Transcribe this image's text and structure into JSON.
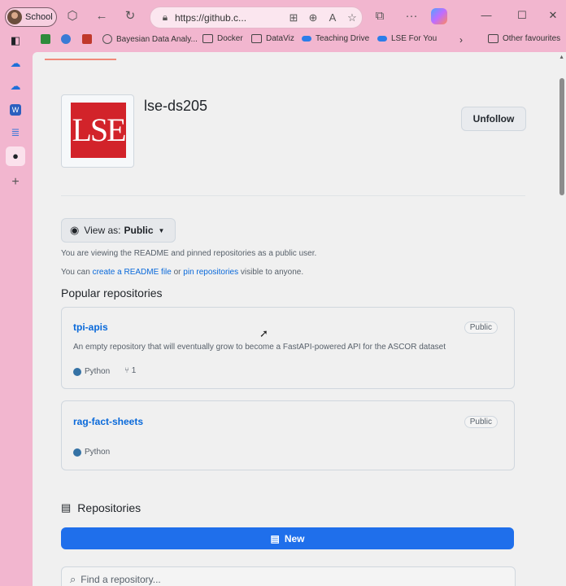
{
  "browser": {
    "profile_label": "School",
    "url": "https://github.c...",
    "favorites": [
      {
        "label": "",
        "icon": "ic-green-icon"
      },
      {
        "label": "",
        "icon": "globe-blue-icon"
      },
      {
        "label": "",
        "icon": "c-red-icon"
      },
      {
        "label": "Bayesian Data Analy...",
        "icon": "globe-icon"
      },
      {
        "label": "Docker",
        "icon": "folder-icon"
      },
      {
        "label": "DataViz",
        "icon": "folder-icon"
      },
      {
        "label": "Teaching Drive",
        "icon": "onedrive-icon"
      },
      {
        "label": "LSE For You",
        "icon": "onedrive-icon"
      },
      {
        "label": "Other favourites",
        "icon": "folder-icon"
      }
    ]
  },
  "profile": {
    "logo_text": "LSE",
    "username": "lse-ds205",
    "unfollow_label": "Unfollow"
  },
  "view_as": {
    "prefix": "View as:",
    "value": "Public"
  },
  "info": {
    "line1": "You are viewing the README and pinned repositories as a public user.",
    "line2_pre": "You can ",
    "line2_link1": "create a README file",
    "line2_mid": " or ",
    "line2_link2": "pin repositories",
    "line2_post": " visible to anyone."
  },
  "popular": {
    "heading": "Popular repositories",
    "repos": [
      {
        "name": "tpi-apis",
        "visibility": "Public",
        "description": "An empty repository that will eventually grow to become a FastAPI-powered API for the ASCOR dataset",
        "language": "Python",
        "language_color": "#3572A5",
        "forks": "1"
      },
      {
        "name": "rag-fact-sheets",
        "visibility": "Public",
        "description": "",
        "language": "Python",
        "language_color": "#3572A5",
        "forks": ""
      }
    ]
  },
  "repositories": {
    "heading": "Repositories",
    "new_label": "New",
    "search_placeholder": "Find a repository..."
  }
}
